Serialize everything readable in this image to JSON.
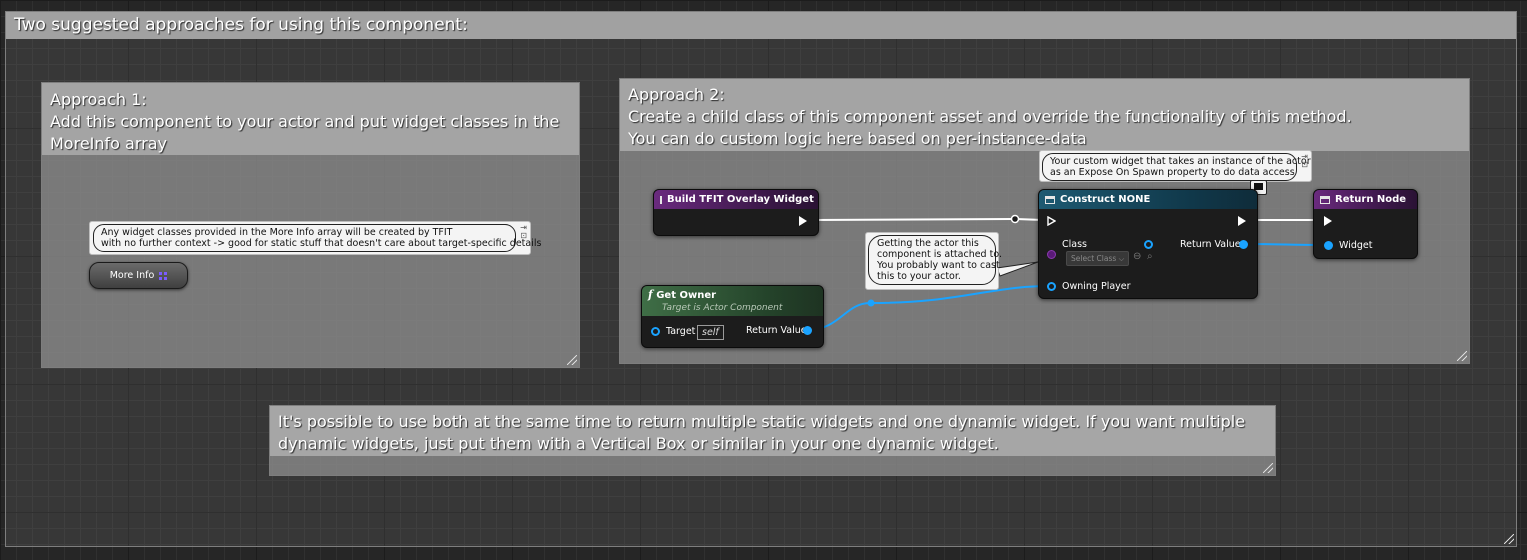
{
  "comments": {
    "outer": "Two suggested approaches for using this component:",
    "approach1": [
      "Approach 1:",
      "Add this component to your actor and put widget classes in the",
      "MoreInfo array"
    ],
    "approach2": [
      "Approach 2:",
      "Create a child class of this component asset and override the functionality of this method.",
      "You can do custom logic here based on per-instance-data"
    ],
    "note": [
      "It's possible to use both at the same time to return multiple static widgets and one dynamic widget. If you want multiple",
      "dynamic widgets, just put them with a Vertical Box or similar in your one dynamic widget."
    ]
  },
  "bubbles": {
    "more_info": [
      "Any widget classes provided in the More Info array will be created by TFIT",
      "with no further context -> good for static stuff that doesn't care about target-specific details"
    ],
    "construct": [
      "Your custom widget that takes an instance of the actor",
      "as an Expose On Spawn property to do data access"
    ],
    "get_owner": [
      "Getting the actor this",
      "component is attached to.",
      "You probably want to cast",
      "this to your actor."
    ]
  },
  "nodes": {
    "more_info": {
      "label": "More Info"
    },
    "build": {
      "title": "Build TFIT Overlay Widget"
    },
    "get_owner": {
      "title": "Get Owner",
      "subtitle": "Target is Actor Component",
      "target_label": "Target",
      "target_value": "self",
      "return_label": "Return Value"
    },
    "construct": {
      "title": "Construct NONE",
      "class_label": "Class",
      "class_placeholder": "Select Class",
      "return_label": "Return Value",
      "owning_player_label": "Owning Player"
    },
    "return_node": {
      "title": "Return Node",
      "widget_label": "Widget"
    }
  },
  "colors": {
    "object_pin": "#1aa3ff",
    "exec_pin": "#ffffff",
    "function_header": "#6a2a7e",
    "pure_header": "#3f6e46",
    "construct_header": "#1e5a72"
  }
}
